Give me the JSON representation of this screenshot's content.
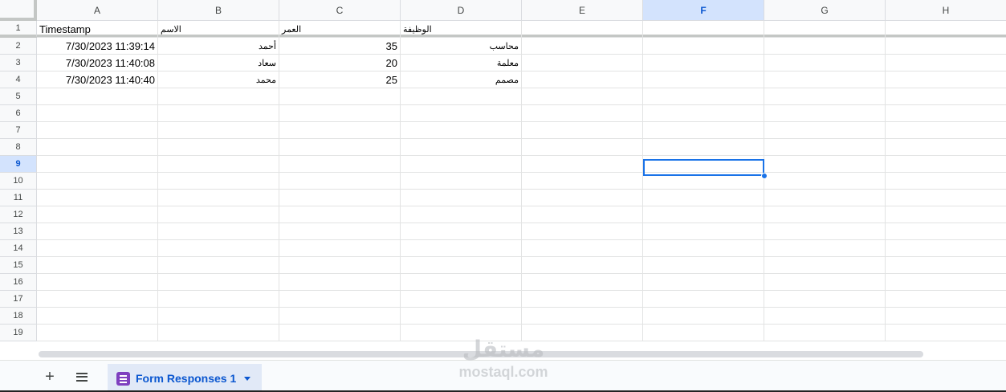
{
  "columns": [
    "A",
    "B",
    "C",
    "D",
    "E",
    "F",
    "G",
    "H"
  ],
  "active_column": "F",
  "rows": [
    "1",
    "2",
    "3",
    "4",
    "5",
    "6",
    "7",
    "8",
    "9",
    "10",
    "11",
    "12",
    "13",
    "14",
    "15",
    "16",
    "17",
    "18",
    "19"
  ],
  "active_row": "9",
  "header_row": {
    "a": "Timestamp",
    "b": "الاسم",
    "c": "العمر",
    "d": "الوظيفة"
  },
  "data_rows": [
    {
      "timestamp": "7/30/2023 11:39:14",
      "name": "أحمد",
      "age": "35",
      "job": "محاسب"
    },
    {
      "timestamp": "7/30/2023 11:40:08",
      "name": "سعاد",
      "age": "20",
      "job": "معلمة"
    },
    {
      "timestamp": "7/30/2023 11:40:40",
      "name": "محمد",
      "age": "25",
      "job": "مصمم"
    }
  ],
  "sheet_bar": {
    "add_sheet_symbol": "+",
    "tab_label": "Form Responses 1"
  },
  "watermark": {
    "logo": "مستقل",
    "text": "mostaql.com"
  },
  "colors": {
    "accent": "#1a73e8",
    "active_header": "#d3e3fd",
    "form_icon": "#7e3fbf"
  }
}
